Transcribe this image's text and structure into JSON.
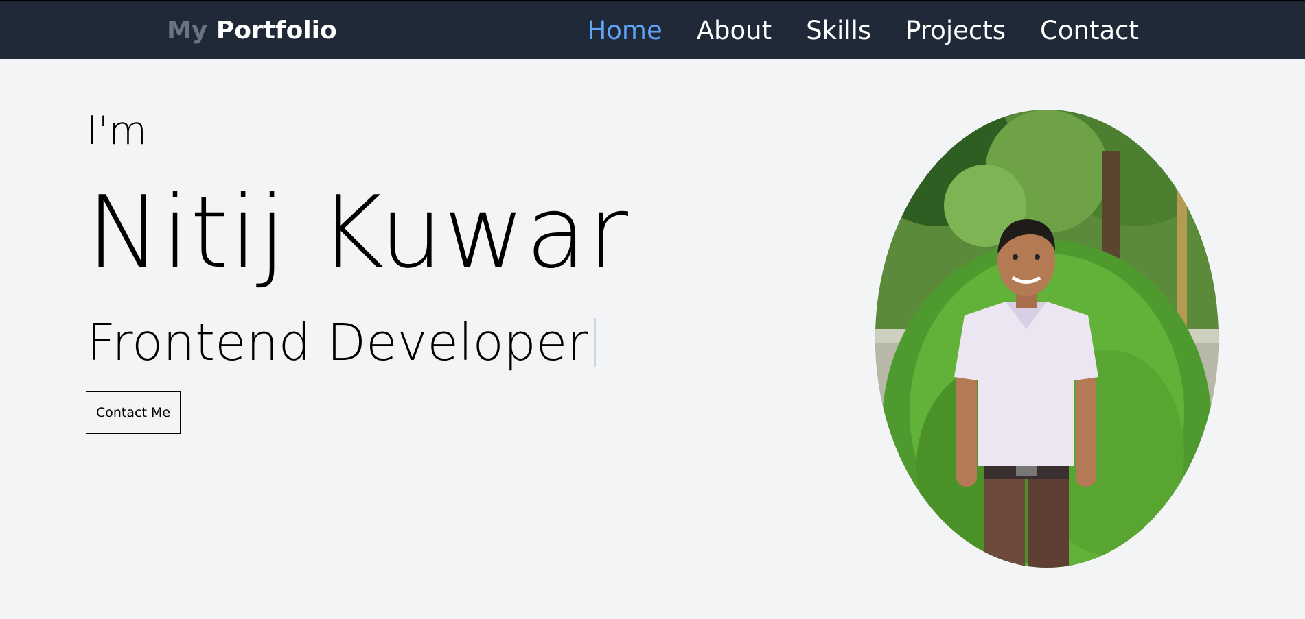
{
  "navbar": {
    "logo_prefix": "My",
    "logo_main": "Portfolio",
    "links": [
      {
        "label": "Home",
        "active": true
      },
      {
        "label": "About",
        "active": false
      },
      {
        "label": "Skills",
        "active": false
      },
      {
        "label": "Projects",
        "active": false
      },
      {
        "label": "Contact",
        "active": false
      }
    ]
  },
  "hero": {
    "greeting": "I'm",
    "name": "Nitij Kuwar",
    "role": "Frontend Developer",
    "cta_label": "Contact Me"
  },
  "colors": {
    "navbar_bg": "#1f2937",
    "active_link": "#60a5fa",
    "page_bg": "#f3f4f6"
  }
}
